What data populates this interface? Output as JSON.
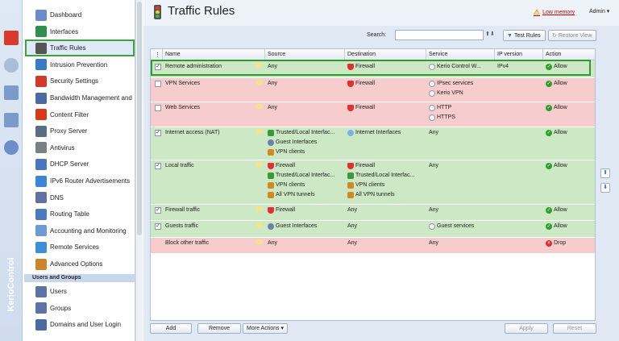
{
  "app": {
    "brand": "KerioControl",
    "page_title": "Traffic Rules",
    "warning": "Low memory",
    "user": "Admin"
  },
  "nav": {
    "items": [
      {
        "label": "Dashboard",
        "icon": "dashboard-icon",
        "color": "#6b8cc7"
      },
      {
        "label": "Interfaces",
        "icon": "interfaces-icon",
        "color": "#2f8f4e"
      },
      {
        "label": "Traffic Rules",
        "icon": "traffic-light-icon",
        "color": "#555555",
        "selected": true
      },
      {
        "label": "Intrusion Prevention",
        "icon": "shield-icon",
        "color": "#3a79c4"
      },
      {
        "label": "Security Settings",
        "icon": "lock-icon",
        "color": "#d13a2a"
      },
      {
        "label": "Bandwidth Management and",
        "icon": "bandwidth-icon",
        "color": "#4b6aa0"
      },
      {
        "label": "Content Filter",
        "icon": "filter-icon",
        "color": "#d63a1a"
      },
      {
        "label": "Proxy Server",
        "icon": "proxy-icon",
        "color": "#5a6d87"
      },
      {
        "label": "Antivirus",
        "icon": "antivirus-icon",
        "color": "#7a7f88"
      },
      {
        "label": "DHCP Server",
        "icon": "dhcp-icon",
        "color": "#4a76c0"
      },
      {
        "label": "IPv6 Router Advertisements",
        "icon": "ipv6-icon",
        "color": "#3e85d8"
      },
      {
        "label": "DNS",
        "icon": "dns-icon",
        "color": "#6272a0"
      },
      {
        "label": "Routing Table",
        "icon": "routing-icon",
        "color": "#4b7bbd"
      },
      {
        "label": "Accounting and Monitoring",
        "icon": "accounting-icon",
        "color": "#6e9bd6"
      },
      {
        "label": "Remote Services",
        "icon": "remote-services-icon",
        "color": "#3d8fd6"
      },
      {
        "label": "Advanced Options",
        "icon": "gear-icon",
        "color": "#c9862c"
      }
    ],
    "section_label": "Users and Groups",
    "section_items": [
      {
        "label": "Users",
        "icon": "user-icon",
        "color": "#5c73a3"
      },
      {
        "label": "Groups",
        "icon": "group-icon",
        "color": "#5c73a3"
      },
      {
        "label": "Domains and User Login",
        "icon": "domain-icon",
        "color": "#4a6aa0"
      }
    ]
  },
  "toolbar": {
    "search_label": "Search:",
    "search_value": "",
    "test_rules": "Test Rules",
    "restore_view": "Restore View"
  },
  "grid": {
    "columns": [
      "Name",
      "Source",
      "Destination",
      "Service",
      "IP version",
      "Action"
    ],
    "rows": [
      {
        "checked": true,
        "name": "Remote administration",
        "bg": "#cce8c4",
        "source": [
          {
            "t": "Any",
            "i": ""
          }
        ],
        "dest": [
          {
            "t": "Firewall",
            "i": "fw"
          }
        ],
        "service": [
          {
            "t": "Kerio Control W...",
            "i": "svc"
          }
        ],
        "ipver": "IPv4",
        "action": "Allow",
        "h": 21
      },
      {
        "checked": false,
        "name": "VPN Services",
        "bg": "#f7cccc",
        "source": [
          {
            "t": "Any",
            "i": ""
          }
        ],
        "dest": [
          {
            "t": "Firewall",
            "i": "fw"
          }
        ],
        "service": [
          {
            "t": "IPsec services",
            "i": "svc"
          },
          {
            "t": "Kerio VPN",
            "i": "svc"
          }
        ],
        "ipver": "",
        "action": "Allow",
        "h": 30
      },
      {
        "checked": false,
        "name": "Web Services",
        "bg": "#f7cccc",
        "source": [
          {
            "t": "Any",
            "i": ""
          }
        ],
        "dest": [
          {
            "t": "Firewall",
            "i": "fw"
          }
        ],
        "service": [
          {
            "t": "HTTP",
            "i": "svc"
          },
          {
            "t": "HTTPS",
            "i": "svc"
          }
        ],
        "ipver": "",
        "action": "Allow",
        "h": 31
      },
      {
        "checked": true,
        "name": "Internet access (NAT)",
        "bg": "#cce8c4",
        "source": [
          {
            "t": "Trusted/Local Interfac...",
            "i": "tr"
          },
          {
            "t": "Guest Interfaces",
            "i": "usr"
          },
          {
            "t": "VPN clients",
            "i": "vpn"
          }
        ],
        "dest": [
          {
            "t": "Internet Interfaces",
            "i": "cloud"
          }
        ],
        "service": [
          {
            "t": "Any",
            "i": ""
          }
        ],
        "ipver": "",
        "action": "Allow",
        "h": 41
      },
      {
        "checked": true,
        "name": "Local traffic",
        "bg": "#cce8c4",
        "source": [
          {
            "t": "Firewall",
            "i": "fw"
          },
          {
            "t": "Trusted/Local Interfac...",
            "i": "tr"
          },
          {
            "t": "VPN clients",
            "i": "vpn"
          },
          {
            "t": "All VPN tunnels",
            "i": "vpn"
          }
        ],
        "dest": [
          {
            "t": "Firewall",
            "i": "fw"
          },
          {
            "t": "Trusted/Local Interfac...",
            "i": "tr"
          },
          {
            "t": "VPN clients",
            "i": "vpn"
          },
          {
            "t": "All VPN tunnels",
            "i": "vpn"
          }
        ],
        "service": [
          {
            "t": "Any",
            "i": ""
          }
        ],
        "ipver": "",
        "action": "Allow",
        "h": 55
      },
      {
        "checked": true,
        "name": "Firewall traffic",
        "bg": "#cce8c4",
        "source": [
          {
            "t": "Firewall",
            "i": "fw"
          }
        ],
        "dest": [
          {
            "t": "Any",
            "i": ""
          }
        ],
        "service": [
          {
            "t": "Any",
            "i": ""
          }
        ],
        "ipver": "",
        "action": "Allow",
        "h": 20
      },
      {
        "checked": true,
        "name": "Guests traffic",
        "bg": "#cce8c4",
        "source": [
          {
            "t": "Guest Interfaces",
            "i": "usr"
          }
        ],
        "dest": [
          {
            "t": "Any",
            "i": ""
          }
        ],
        "service": [
          {
            "t": "Guest services",
            "i": "svc"
          }
        ],
        "ipver": "",
        "action": "Allow",
        "h": 21
      },
      {
        "checked": null,
        "name": "Block other traffic",
        "bg": "#f7cccc",
        "source": [
          {
            "t": "Any",
            "i": ""
          }
        ],
        "dest": [
          {
            "t": "Any",
            "i": ""
          }
        ],
        "service": [
          {
            "t": "Any",
            "i": ""
          }
        ],
        "ipver": "",
        "action": "Drop",
        "h": 20
      }
    ]
  },
  "bottom": {
    "add": "Add",
    "remove": "Remove",
    "more_actions": "More Actions",
    "apply": "Apply",
    "reset": "Reset"
  }
}
